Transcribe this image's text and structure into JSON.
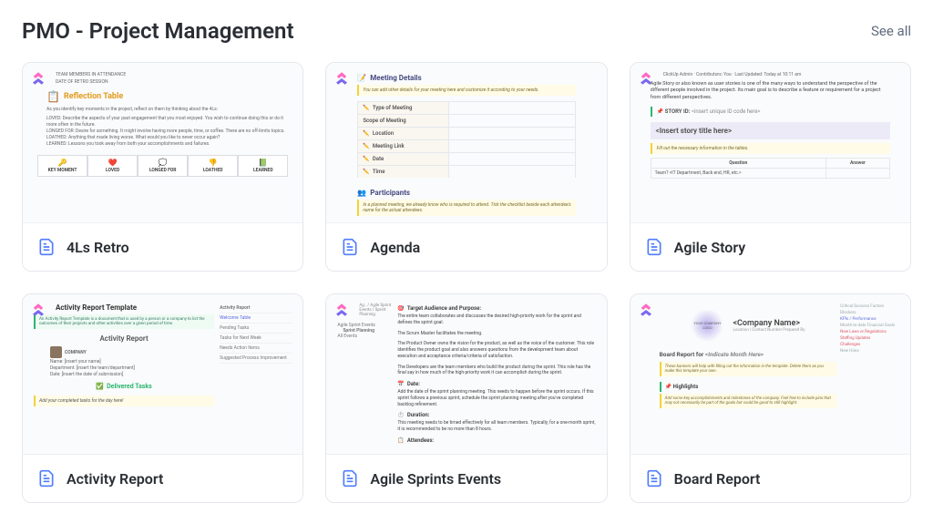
{
  "header": {
    "title": "PMO - Project Management",
    "see_all": "See all"
  },
  "cards": {
    "retro": {
      "title": "4Ls Retro",
      "preview": {
        "hdr1": "TEAM MEMBERS IN ATTENDANCE",
        "hdr2": "DATE OF RETRO SESSION",
        "reflection_title": "Reflection Table",
        "intro": "As you identify key moments in the project, reflect on them by thinking about the 4Ls:",
        "loved": "LOVED: Describe the aspects of your past engagement that you most enjoyed. You wish to continue doing this or do it more often in the future.",
        "longed": "LONGED FOR: Desire for something. It might involve having more people, time, or coffee. There are no off-limits topics.",
        "loathed": "LOATHED: Anything that made living worse. What would you like to never occur again?",
        "learned": "LEARNED: Lessons you took away from both your accomplishments and failures.",
        "cols": [
          "KEY MOMENT",
          "LOVED",
          "LONGED FOR",
          "LOATHED",
          "LEARNED"
        ],
        "icons": [
          "🔑",
          "❤️",
          "💭",
          "👎",
          "📗"
        ]
      }
    },
    "agenda": {
      "title": "Agenda",
      "preview": {
        "section": "Meeting Details",
        "note": "You can add other details for your meeting here and customize it according to your needs.",
        "fields": [
          "Type of Meeting",
          "Scope of Meeting",
          "Location",
          "Meeting Link",
          "Date",
          "Time"
        ],
        "participants": "Participants",
        "p_note": "In a planned meeting, we already know who is required to attend. Tick the checklist beside each attendee's name for the actual attendees."
      }
    },
    "story": {
      "title": "Agile Story",
      "preview": {
        "meta": "ClickUp Admin  ·  Contributors: You  ·  Last Updated: Today at 10:11 am",
        "desc": "Agile Story or also known as user stories is one of the many ways to understand the perspective of the different people involved in the project. Its main goal is to describe a feature or requirement for a project from different perspectives.",
        "story_label": "STORY ID:",
        "story_code": "<insert unique ID code here>",
        "story_title": "<Insert story title here>",
        "fill": "Fill out the necessary information in the tables.",
        "q_header": "Question",
        "a_header": "Answer",
        "q1": "Team? <IT Department, Back end, HR, etc.>"
      }
    },
    "activity": {
      "title": "Activity Report",
      "preview": {
        "big": "Activity Report Template",
        "note": "An Activity Report Template is a document that is used by a person or a company to list the outcomes of their projects and other activities over a given period of time.",
        "report": "Activity Report",
        "name_row": "Name: [insert your name]",
        "dept_row": "Department: [insert the team/department]",
        "date_row": "Date: [insert the date of submission]",
        "delivered": "Delivered Tasks",
        "yellow": "Add your completed tasks for the day here!",
        "side_title": "Activity Report",
        "side_items": [
          "Welcome Table",
          "Pending Tasks",
          "Tasks for Next Week",
          "Needs Action Items",
          "Suggested Process Improvement"
        ]
      }
    },
    "sprints": {
      "title": "Agile Sprints Events",
      "preview": {
        "crumb": "Ag.. / Agile Sprint Events / Sprint Planning",
        "side_items": [
          "Agile Sprint Events",
          "Sprint Planning",
          "All Events"
        ],
        "s1_title": "Target Audience and Purpose:",
        "s1_p1": "The entire team collaborates and discusses the desired high-priority work for the sprint and defines the sprint goal.",
        "s1_p2": "The Scrum Master facilitates the meeting.",
        "s1_p3": "The Product Owner owns the vision for the product, as well as the voice of the customer. This role identifies the product goal and also answers questions from the development team about execution and acceptance criteria/criteria of satisfaction.",
        "s1_p4": "The Developers are the team members who build the product during the sprint. This role has the final say in how much of the high-priority work it can accomplish during the sprint.",
        "s2_title": "Date:",
        "s2_p": "Add the date of the sprint planning meeting. This needs to happen before the sprint occurs. If this sprint follows a previous sprint, schedule the sprint planning meeting after you've completed backlog refinement.",
        "s3_title": "Duration:",
        "s3_p": "This meeting needs to be timed effectively for all team members. Typically, for a one-month sprint, it is recommended to be no more than 8 hours.",
        "s4_title": "Attendees:"
      }
    },
    "board": {
      "title": "Board Report",
      "preview": {
        "logo": "YOUR COMPANY LOGO",
        "cname": "<Company Name>",
        "csub": "Location | Contact Number\nPrepared By",
        "board_for": "Board Report for ",
        "indicate": "<Indicate Month Here>",
        "banner": "These banners will help with filling out the information in the template. Delete them as you make this template your own.",
        "highlights": "Highlights",
        "h_note": "Add some key accomplishments and milestones of the company. Feel free to include pins that may not necessarily be part of the goals but could be good to still highlight.",
        "side_items": [
          "Critical Success Factors",
          "Blockers",
          "KPIs / Performance",
          "Month-to-date Financial Goals",
          "New Laws or Regulations",
          "Staffing Updates",
          "Challenges",
          "New Hires"
        ]
      }
    }
  }
}
